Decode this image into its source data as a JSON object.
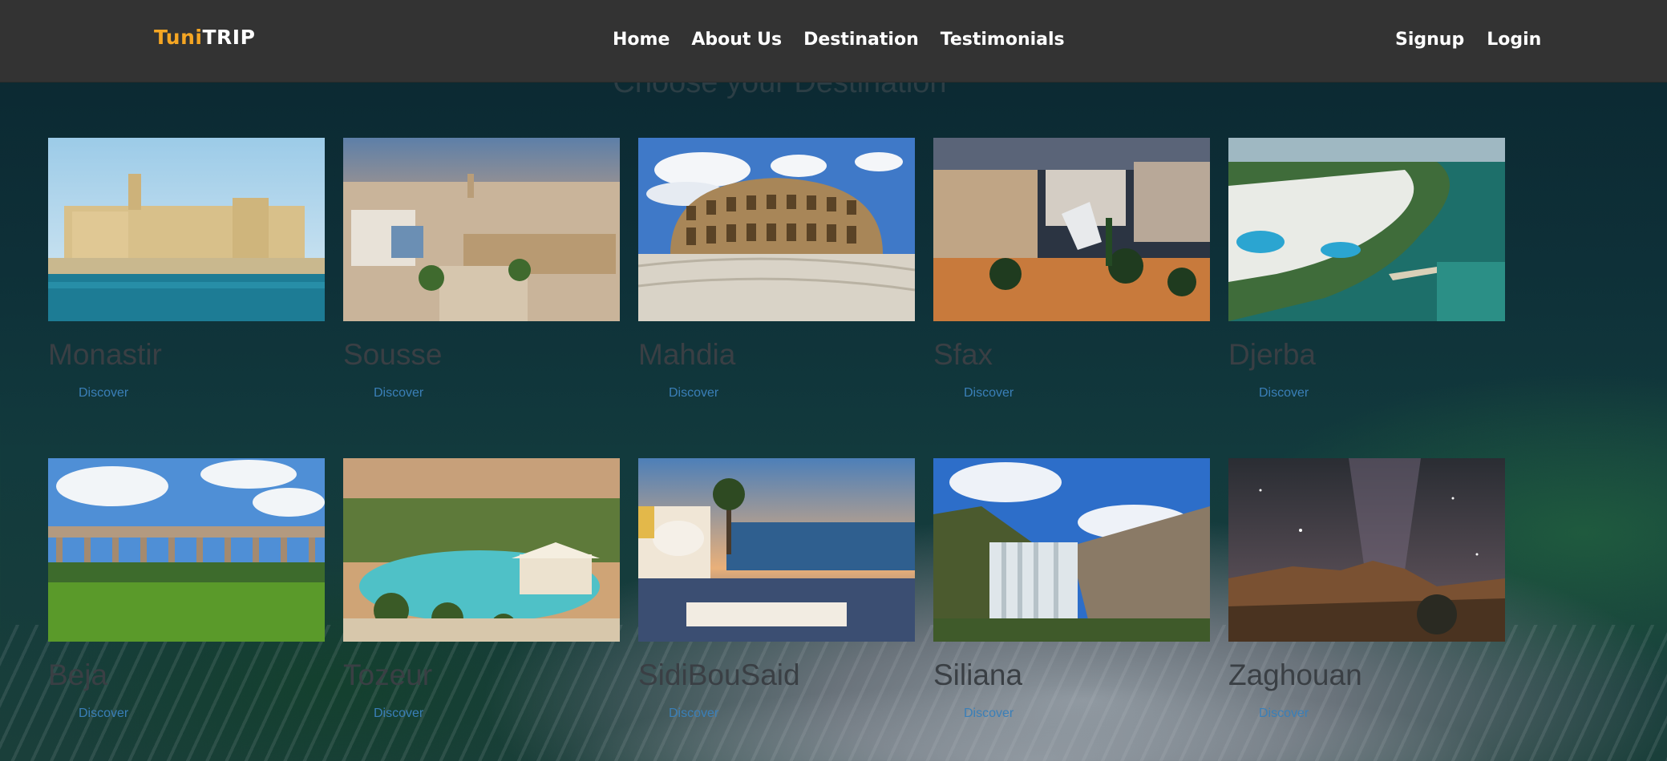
{
  "brand": {
    "part1": "Tuni",
    "part2": "TRIP",
    "accent": "#f5a623"
  },
  "nav": {
    "center": [
      "Home",
      "About Us",
      "Destination",
      "Testimonials"
    ],
    "right": [
      "Signup",
      "Login"
    ]
  },
  "section_title": "Choose your Destination",
  "destinations": [
    {
      "name": "Monastir",
      "link": "Discover"
    },
    {
      "name": "Sousse",
      "link": "Discover"
    },
    {
      "name": "Mahdia",
      "link": "Discover"
    },
    {
      "name": "Sfax",
      "link": "Discover"
    },
    {
      "name": "Djerba",
      "link": "Discover"
    },
    {
      "name": "Beja",
      "link": "Discover"
    },
    {
      "name": "Tozeur",
      "link": "Discover"
    },
    {
      "name": "SidiBouSaid",
      "link": "Discover"
    },
    {
      "name": "Siliana",
      "link": "Discover"
    },
    {
      "name": "Zaghouan",
      "link": "Discover"
    }
  ]
}
